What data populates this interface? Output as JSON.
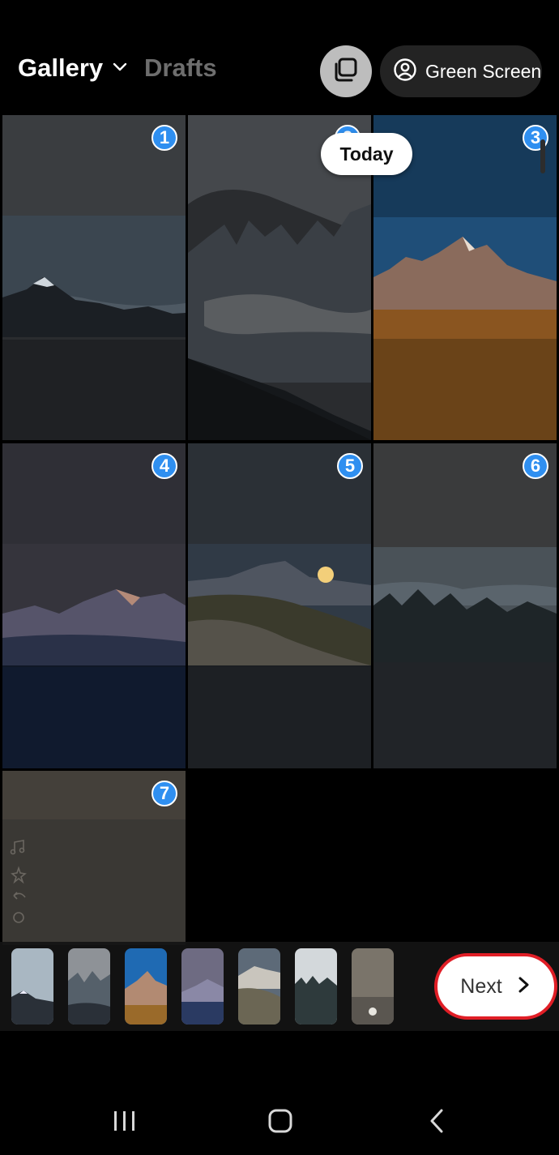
{
  "header": {
    "gallery_label": "Gallery",
    "drafts_label": "Drafts",
    "green_screen_label": "Green Screen"
  },
  "grid": {
    "today_label": "Today",
    "badges": [
      "1",
      "2",
      "3",
      "4",
      "5",
      "6",
      "7"
    ]
  },
  "tray": {
    "next_label": "Next",
    "thumbnail_count": 7
  },
  "colors": {
    "badge": "#2f8ff0",
    "next_button_border": "#e01e26",
    "drafts_inactive": "#6e6e6e"
  },
  "icons": {
    "gallery_dropdown": "chevron-down-icon",
    "multi_select": "stacked-squares-icon",
    "green_screen": "person-circle-icon",
    "next": "chevron-right-icon",
    "nav_recents": "recents-icon",
    "nav_home": "home-icon",
    "nav_back": "back-icon"
  }
}
